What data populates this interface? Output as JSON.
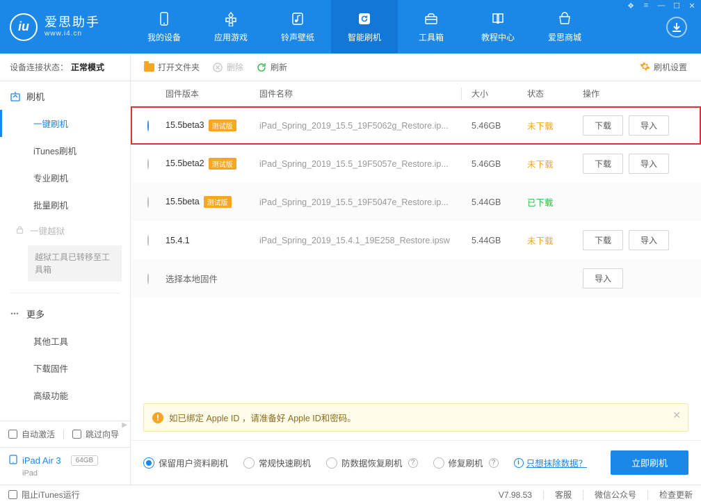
{
  "app": {
    "title_cn": "爱思助手",
    "title_en": "www.i4.cn"
  },
  "nav": {
    "items": [
      {
        "label": "我的设备",
        "icon": "phone"
      },
      {
        "label": "应用游戏",
        "icon": "apps"
      },
      {
        "label": "铃声壁纸",
        "icon": "music"
      },
      {
        "label": "智能刷机",
        "icon": "refresh",
        "active": true
      },
      {
        "label": "工具箱",
        "icon": "toolbox"
      },
      {
        "label": "教程中心",
        "icon": "book"
      },
      {
        "label": "爱思商城",
        "icon": "shop"
      }
    ]
  },
  "toolbar": {
    "conn_label": "设备连接状态：",
    "conn_value": "正常模式",
    "open_folder": "打开文件夹",
    "delete": "删除",
    "refresh": "刷新",
    "settings": "刷机设置"
  },
  "sidebar": {
    "group1": {
      "title": "刷机",
      "icon": "flash"
    },
    "items1": [
      "一键刷机",
      "iTunes刷机",
      "专业刷机",
      "批量刷机"
    ],
    "jailbreak": "一键越狱",
    "jailbreak_note": "越狱工具已转移至工具箱",
    "group2": {
      "title": "更多"
    },
    "items2": [
      "其他工具",
      "下载固件",
      "高级功能"
    ],
    "auto_activate": "自动激活",
    "skip_guide": "跳过向导",
    "device_name": "iPad Air 3",
    "device_storage": "64GB",
    "device_type": "iPad"
  },
  "columns": {
    "version": "固件版本",
    "name": "固件名称",
    "size": "大小",
    "status": "状态",
    "ops": "操作"
  },
  "firmware": [
    {
      "selected": true,
      "version": "15.5beta3",
      "beta": "测试版",
      "name": "iPad_Spring_2019_15.5_19F5062g_Restore.ip...",
      "size": "5.46GB",
      "status": "未下载",
      "status_cls": "st-orange",
      "dl": true,
      "imp": true,
      "hl": true
    },
    {
      "selected": false,
      "version": "15.5beta2",
      "beta": "测试版",
      "name": "iPad_Spring_2019_15.5_19F5057e_Restore.ip...",
      "size": "5.46GB",
      "status": "未下载",
      "status_cls": "st-orange",
      "dl": true,
      "imp": true
    },
    {
      "selected": false,
      "version": "15.5beta",
      "beta": "测试版",
      "name": "iPad_Spring_2019_15.5_19F5047e_Restore.ip...",
      "size": "5.44GB",
      "status": "已下载",
      "status_cls": "st-green",
      "dl": false,
      "imp": false,
      "alt": true
    },
    {
      "selected": false,
      "version": "15.4.1",
      "beta": "",
      "name": "iPad_Spring_2019_15.4.1_19E258_Restore.ipsw",
      "size": "5.44GB",
      "status": "未下载",
      "status_cls": "st-orange",
      "dl": true,
      "imp": true
    },
    {
      "selected": false,
      "version": "选择本地固件",
      "beta": "",
      "name": "",
      "size": "",
      "status": "",
      "status_cls": "",
      "dl": false,
      "imp": true,
      "alt": true,
      "local": true
    }
  ],
  "buttons": {
    "download": "下载",
    "import": "导入"
  },
  "banner": "如已绑定 Apple ID ，请准备好 Apple ID和密码。",
  "flash_options": {
    "opt1": "保留用户资料刷机",
    "opt2": "常规快速刷机",
    "opt3": "防数据恢复刷机",
    "opt4": "修复刷机",
    "erase": "只想抹除数据？",
    "start": "立即刷机"
  },
  "status": {
    "block_itunes": "阻止iTunes运行",
    "version": "V7.98.53",
    "svc": "客服",
    "wechat": "微信公众号",
    "check": "检查更新"
  }
}
